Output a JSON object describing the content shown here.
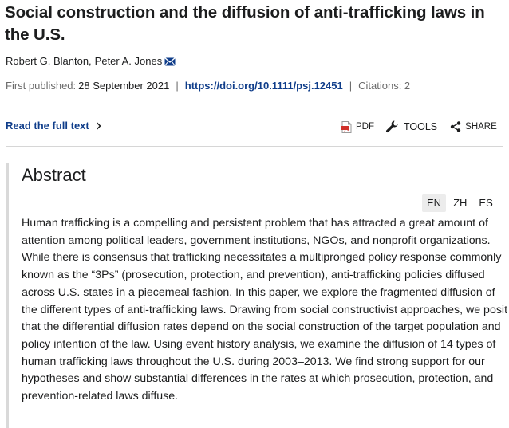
{
  "article": {
    "title": "Social construction and the diffusion of anti-trafficking laws in the U.S.",
    "authors": [
      "Robert G. Blanton,",
      "Peter A. Jones"
    ],
    "first_published_label": "First published:",
    "first_published_date": "28 September 2021",
    "doi": "https://doi.org/10.1111/psj.12451",
    "citations": "Citations: 2"
  },
  "actions": {
    "full_text": "Read the full text",
    "pdf": "PDF",
    "tools": "TOOLS",
    "share": "SHARE"
  },
  "abstract": {
    "heading": "Abstract",
    "languages": [
      "EN",
      "ZH",
      "ES"
    ],
    "active_language": "EN",
    "text": "Human trafficking is a compelling and persistent problem that has attracted a great amount of attention among political leaders, government institutions, NGOs, and nonprofit organizations. While there is consensus that trafficking necessitates a multipronged policy response commonly known as the “3Ps” (prosecution, protection, and prevention), anti-trafficking policies diffused across U.S. states in a piecemeal fashion. In this paper, we explore the fragmented diffusion of the different types of anti-trafficking laws. Drawing from social constructivist approaches, we posit that the differential diffusion rates depend on the social construction of the target population and policy intention of the law. Using event history analysis, we examine the diffusion of 14 types of human trafficking laws throughout the U.S. during 2003–2013. We find strong support for our hypotheses and show substantial differences in the rates at which prosecution, protection, and prevention-related laws diffuse."
  },
  "icons": {
    "mail": "envelope-icon",
    "chevron": "chevron-right-icon",
    "pdf": "pdf-file-icon",
    "tools": "wrench-icon",
    "share": "share-icon"
  },
  "colors": {
    "link": "#0f3d8a",
    "pdf_red": "#d0302a",
    "abstract_border": "#d9d9d9"
  }
}
